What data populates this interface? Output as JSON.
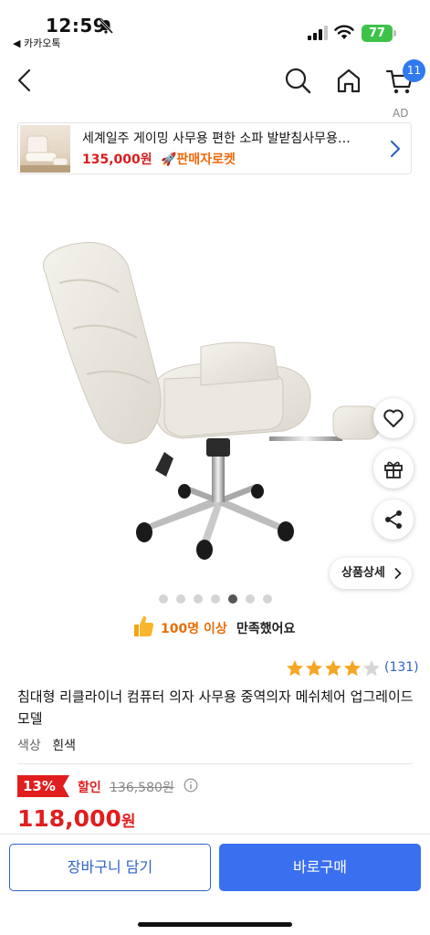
{
  "status_bar": {
    "time": "12:59",
    "back_app": "◀ 카카오톡",
    "battery": "77"
  },
  "nav": {
    "cart_count": "11"
  },
  "ad": {
    "label": "AD",
    "title": "세계일주 게이밍 사무용 편한 소파 발받침사무용…",
    "price": "135,000원",
    "badge": "🚀판매자로켓"
  },
  "gallery": {
    "detail_label": "상품상세 ›",
    "detail_text": "상품상세",
    "dot_count": 7,
    "active_index": 4
  },
  "satisfaction": {
    "count": "100명 이상",
    "text": "만족했어요"
  },
  "rating": {
    "stars": 4,
    "max": 5,
    "reviews": "(131)"
  },
  "product": {
    "title": "침대형 리클라이너 컴퓨터 의자 사무용 중역의자 메쉬체어 업그레이드 모델",
    "option_label": "색상",
    "option_value": "흰색"
  },
  "price": {
    "discount": "13%",
    "discount_label": "할인",
    "original": "136,580원",
    "sale": "118,000",
    "sale_unit": "원"
  },
  "actions": {
    "cart": "장바구니 담기",
    "buy": "바로구매"
  },
  "colors": {
    "accent_blue": "#3a6ff0",
    "price_red": "#e01e1e",
    "rocket_orange": "#f0670a",
    "star_gold": "#f5a623"
  }
}
